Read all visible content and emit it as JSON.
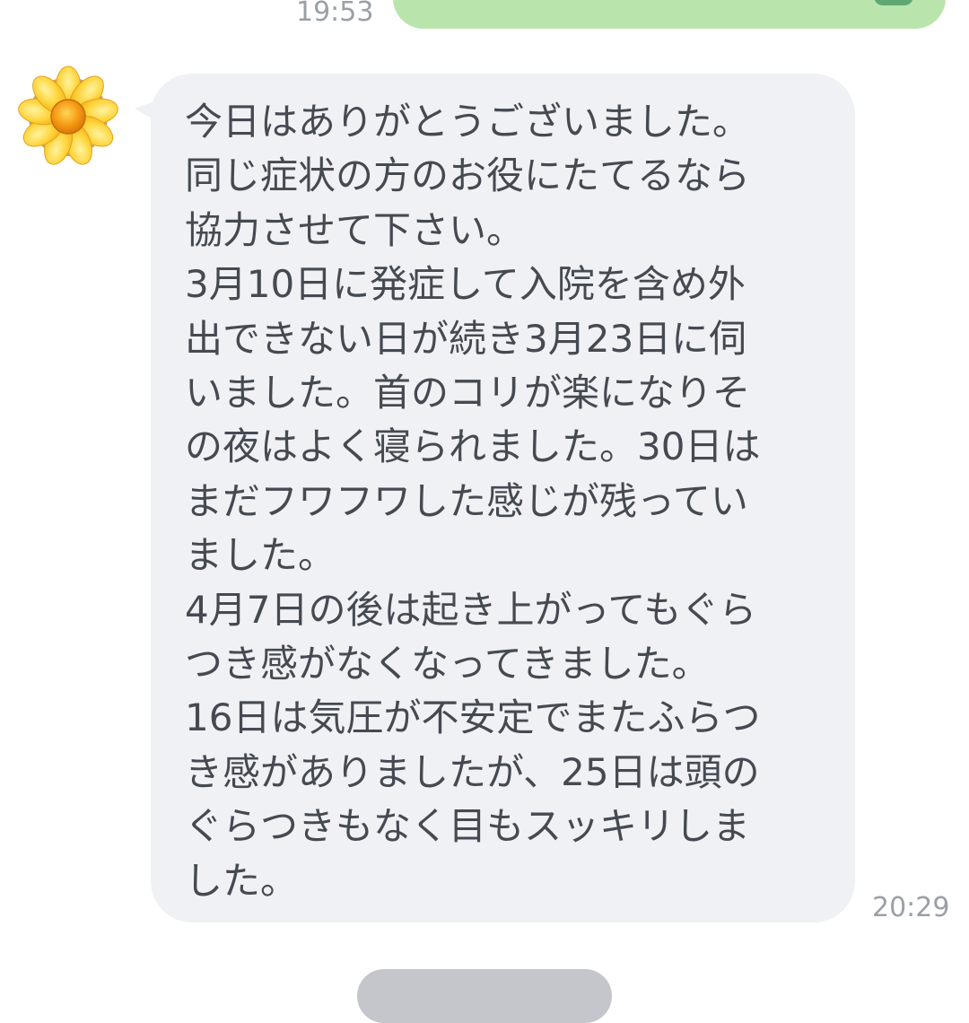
{
  "chat": {
    "sent_message": {
      "time": "19:53"
    },
    "received_message": {
      "text": "今日はありがとうございました。\n同じ症状の方のお役にたてるなら\n協力させて下さい。\n3月10日に発症して入院を含め外\n出できない日が続き3月23日に伺\nいました。首のコリが楽になりそ\nの夜はよく寝られました。30日は\nまだフワフワした感じが残ってい\nました。\n4月7日の後は起き上がってもぐら\nつき感がなくなってきました。\n16日は気圧が不安定でまたふらつ\nき感がありましたが、25日は頭の\nぐらつきもなく目もスッキリしま\nした。",
      "time": "20:29",
      "avatar_icon": "sunflower-icon"
    },
    "date_separator": ""
  },
  "colors": {
    "sent_bubble": "#b9e5ac",
    "received_bubble": "#f0f1f4",
    "message_text": "#454a52",
    "timestamp": "#9aa0a6",
    "date_pill": "#c4c6cc"
  }
}
